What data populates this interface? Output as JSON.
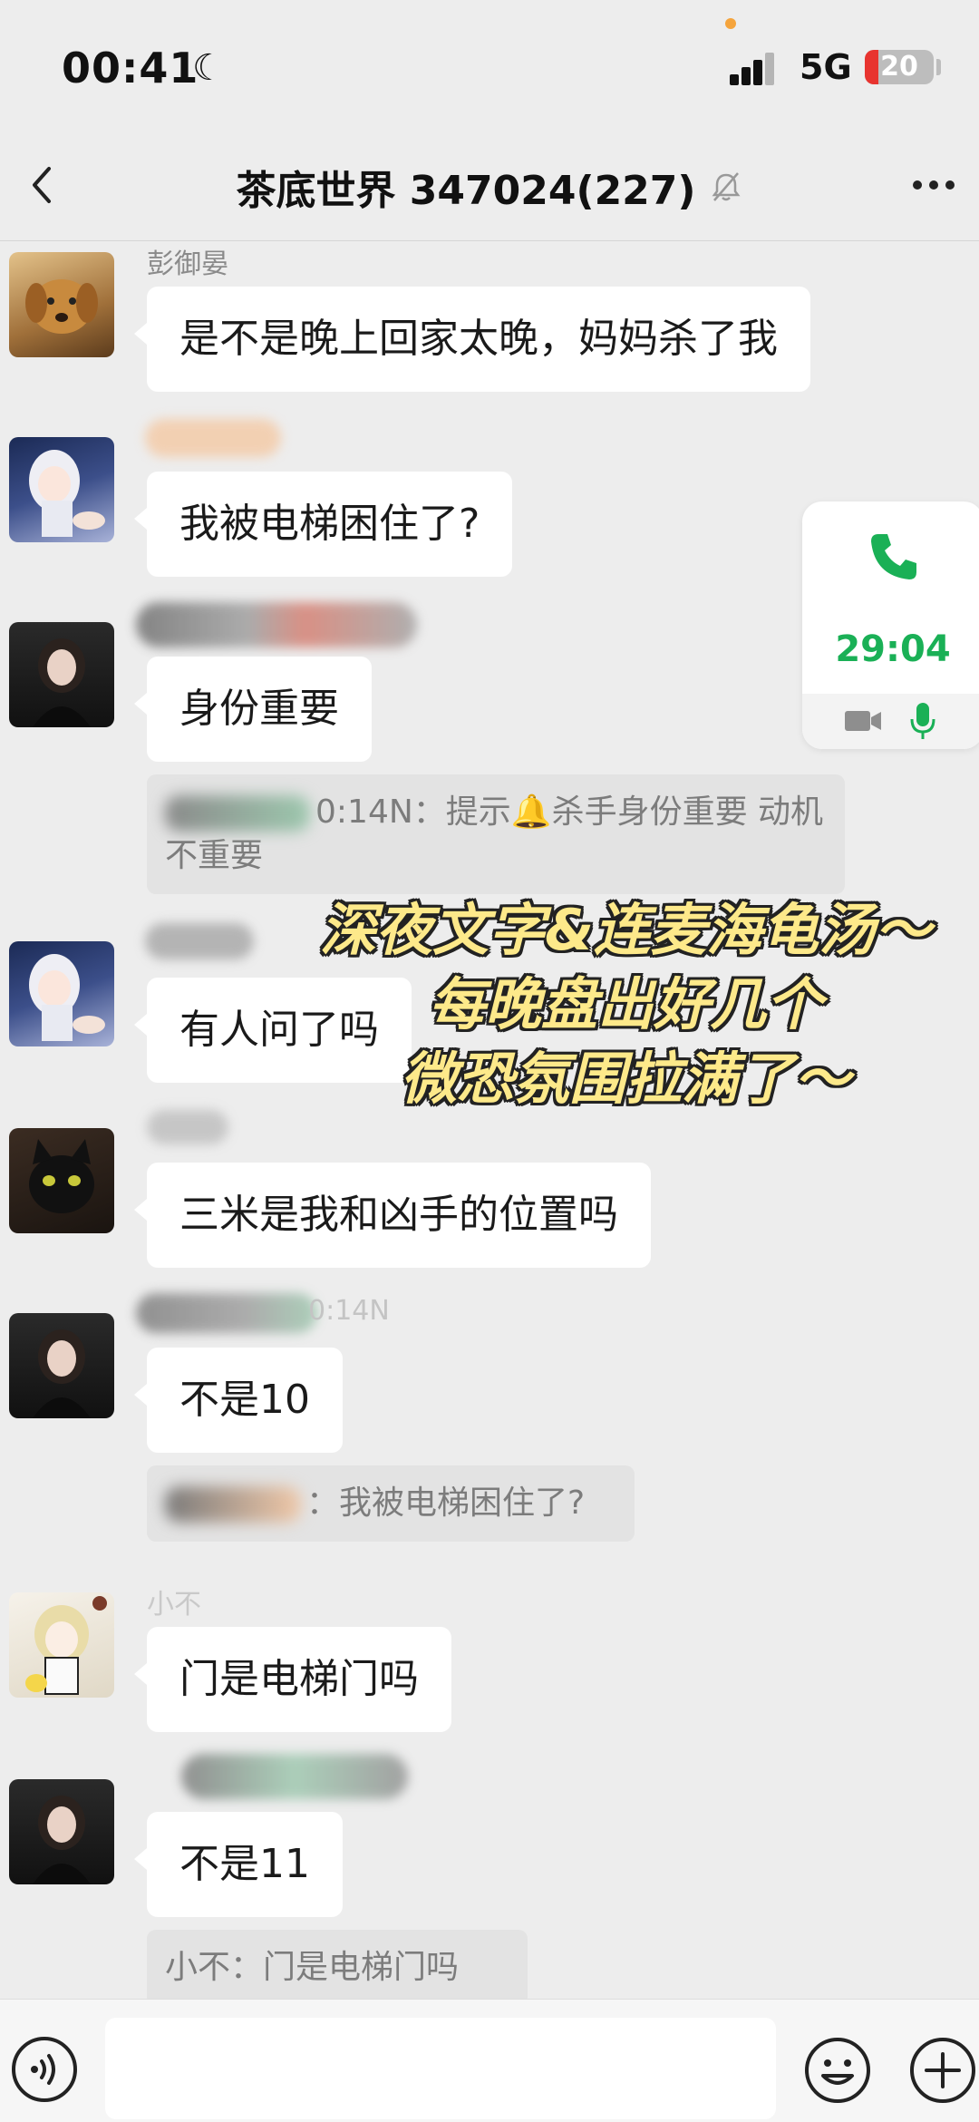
{
  "status_bar": {
    "time": "00:41",
    "network": "5G",
    "battery": 20
  },
  "header": {
    "title": "茶底世界 347024(227)",
    "mute_icon": "bell-muted-icon"
  },
  "messages": [
    {
      "nickname": "彭御晏",
      "text": "是不是晚上回家太晚，妈妈杀了我",
      "avatar": "golden-dog-avatar"
    },
    {
      "nickname": "",
      "text": "我被电梯困住了?",
      "avatar": "anime-girl-avatar"
    },
    {
      "nickname": "",
      "text": "身份重要",
      "avatar": "woman-portrait-avatar",
      "quote": "0:14N：提示🔔杀手身份重要 动机不重要"
    },
    {
      "nickname": "",
      "text": "有人问了吗",
      "avatar": "anime-girl-avatar"
    },
    {
      "nickname": "",
      "text": "三米是我和凶手的位置吗",
      "avatar": "black-cat-avatar"
    },
    {
      "nickname": "0:14N",
      "text": "不是10",
      "avatar": "woman-portrait-avatar",
      "quote": "：我被电梯困住了?"
    },
    {
      "nickname": "小不",
      "text": "门是电梯门吗",
      "avatar": "anime-blonde-avatar"
    },
    {
      "nickname": "",
      "text": "不是11",
      "avatar": "woman-portrait-avatar",
      "quote": "小不：门是电梯门吗"
    }
  ],
  "call_widget": {
    "duration": "29:04",
    "accent": "#1ab056"
  },
  "banner": {
    "line1": "深夜文字&连麦海龟汤～",
    "line2": "每晚盘出好几个",
    "line3": "微恐氛围拉满了～"
  },
  "input_bar": {
    "placeholder": ""
  }
}
